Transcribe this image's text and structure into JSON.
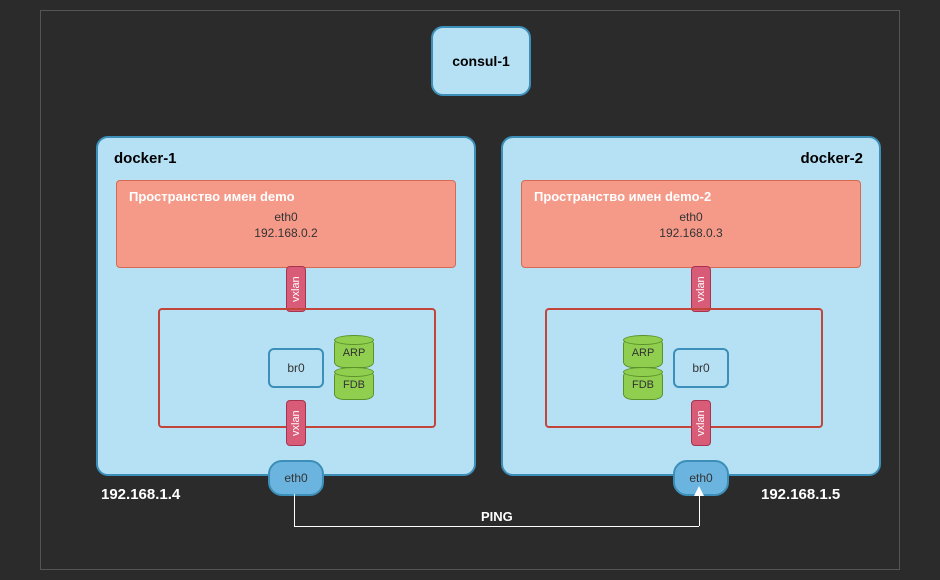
{
  "consul": {
    "label": "consul-1"
  },
  "host1": {
    "label": "docker-1",
    "namespace": {
      "title": "Пространство имен demo",
      "if": "eth0",
      "ip": "192.168.0.2"
    },
    "vxlan_top": "vxlan",
    "vxlan_bottom": "vxlan",
    "bridge": "br0",
    "arp": "ARP",
    "fdb": "FDB",
    "eth": "eth0",
    "host_ip": "192.168.1.4"
  },
  "host2": {
    "label": "docker-2",
    "namespace": {
      "title": "Пространство имен demo-2",
      "if": "eth0",
      "ip": "192.168.0.3"
    },
    "vxlan_top": "vxlan",
    "vxlan_bottom": "vxlan",
    "bridge": "br0",
    "arp": "ARP",
    "fdb": "FDB",
    "eth": "eth0",
    "host_ip": "192.168.1.5"
  },
  "ping_label": "PING"
}
